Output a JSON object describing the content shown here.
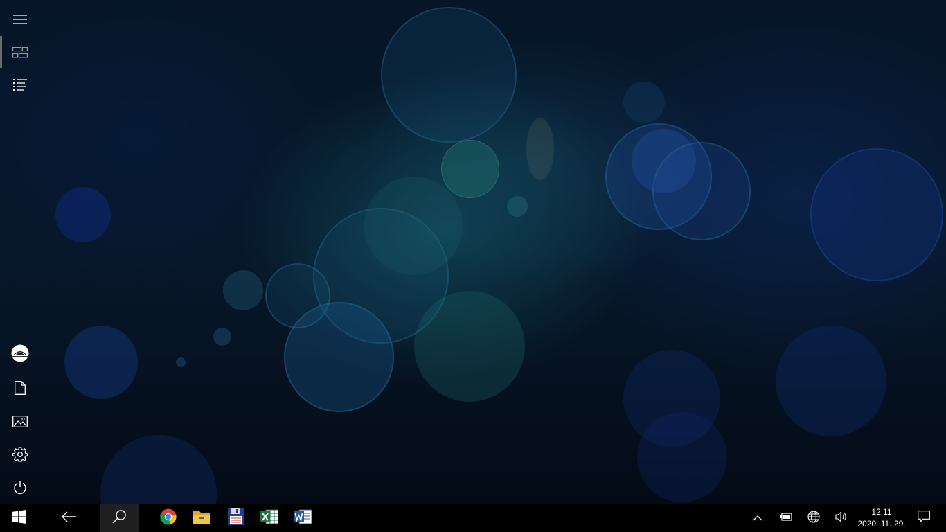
{
  "rail": {
    "items": [
      {
        "name": "hamburger-menu",
        "icon": "hamburger-icon"
      },
      {
        "name": "tiles-view",
        "icon": "tiles-icon",
        "active": true
      },
      {
        "name": "all-apps-list",
        "icon": "list-icon"
      },
      {
        "name": "user-account",
        "icon": "avatar-icon"
      },
      {
        "name": "documents",
        "icon": "document-icon"
      },
      {
        "name": "pictures",
        "icon": "picture-icon"
      },
      {
        "name": "settings",
        "icon": "gear-icon"
      },
      {
        "name": "power",
        "icon": "power-icon"
      }
    ]
  },
  "taskbar": {
    "pinned": [
      {
        "name": "chrome",
        "icon": "chrome-icon"
      },
      {
        "name": "file-explorer",
        "icon": "folder-icon"
      },
      {
        "name": "save-app",
        "icon": "floppy-icon"
      },
      {
        "name": "excel",
        "icon": "excel-icon"
      },
      {
        "name": "word",
        "icon": "word-icon"
      }
    ],
    "clock": {
      "time": "12:11",
      "date": "2020. 11. 29."
    }
  },
  "colors": {
    "taskbar_bg": "#000000",
    "search_bg": "#1f1f1f",
    "chrome_red": "#db4437",
    "chrome_yellow": "#f4c20d",
    "chrome_green": "#0f9d58",
    "chrome_blue": "#4285f4",
    "folder_yellow": "#f6c344",
    "excel_green": "#1e7145",
    "word_blue": "#2b579a"
  }
}
